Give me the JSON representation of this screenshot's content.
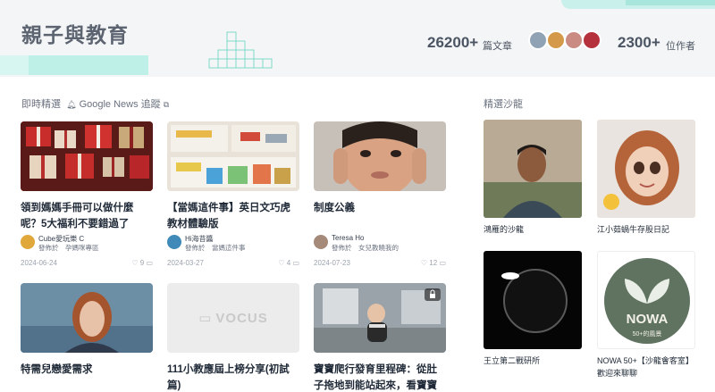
{
  "header": {
    "title": "親子與教育",
    "articles_count": "26200+",
    "articles_label": "篇文章",
    "authors_count": "2300+",
    "authors_label": "位作者"
  },
  "colors": {
    "accent_teal": "#bff0e8",
    "header_bg": "#f4f5f6",
    "title_gray": "#5b6470"
  },
  "news": {
    "label": "即時精選",
    "source": "Google News 追蹤",
    "source_icon": "external-link-icon"
  },
  "salon_section": {
    "label": "精選沙龍"
  },
  "cards": [
    {
      "title": "領到媽媽手冊可以做什麼呢？5大福利不要錯過了",
      "author": "Cube愛玩樂 C",
      "published_in": "發佈於　孕媽咪專區",
      "date": "2024-06-24",
      "count": "9"
    },
    {
      "title": "【當媽這件事】英日文巧虎教材體驗版",
      "author": "Hi海苔醬",
      "published_in": "發佈於　當媽這件事",
      "date": "2024-03-27",
      "count": "4"
    },
    {
      "title": "制度公義",
      "author": "Teresa Ho",
      "published_in": "發佈於　女兒教曉我的",
      "date": "2024-07-23",
      "count": "12"
    },
    {
      "title": "特需兒戀愛需求"
    },
    {
      "title": "111小教應屆上榜分享(初試篇)",
      "thumb_text": "vocus"
    },
    {
      "title": "寶寶爬行發育里程碑：從肚子拖地到能站起來，看寶寶爬行成..."
    }
  ],
  "salons": [
    {
      "title": "鴻雁的沙龍"
    },
    {
      "title": "江小茹蝸牛存股日記"
    },
    {
      "title": "王立第二戰研所"
    },
    {
      "title": "NOWA 50+【沙龍會客室】歡迎來聊聊",
      "logo_text": "NOWA",
      "logo_sub": "50+的風景"
    }
  ]
}
